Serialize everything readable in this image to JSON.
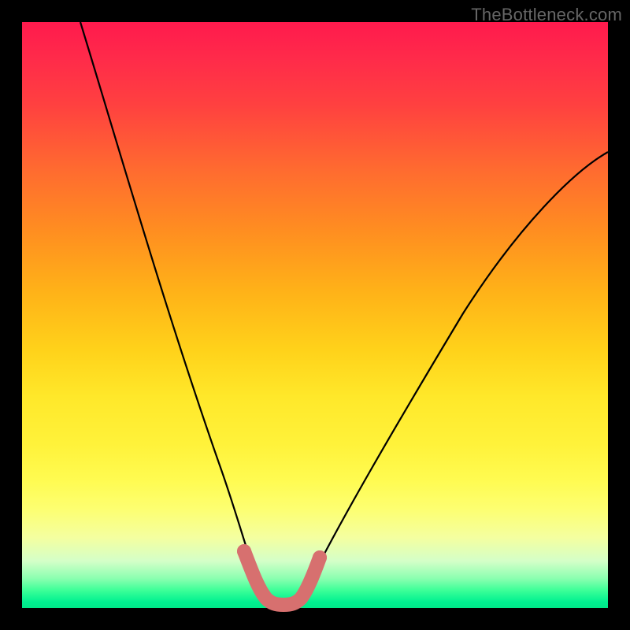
{
  "watermark": "TheBottleneck.com",
  "chart_data": {
    "type": "line",
    "title": "",
    "xlabel": "",
    "ylabel": "",
    "xlim": [
      0,
      100
    ],
    "ylim": [
      0,
      100
    ],
    "grid": false,
    "legend": false,
    "background": "rainbow-vertical",
    "series": [
      {
        "name": "bottleneck-curve",
        "color": "#000000",
        "x": [
          10,
          12,
          14,
          16,
          18,
          20,
          22,
          24,
          26,
          28,
          30,
          32,
          34,
          36,
          38,
          39,
          40,
          41,
          42,
          43,
          45,
          47,
          49,
          52,
          56,
          60,
          65,
          70,
          76,
          82,
          88,
          94,
          100
        ],
        "values": [
          100,
          92,
          84,
          77,
          70,
          63,
          57,
          51,
          45,
          39,
          33,
          27,
          22,
          16,
          10,
          6,
          3,
          1,
          1,
          1,
          3,
          6,
          10,
          15,
          21,
          28,
          35,
          42,
          50,
          57,
          64,
          70,
          76
        ]
      },
      {
        "name": "valley-highlight",
        "color": "#d7706f",
        "thickness": "thick",
        "x": [
          37.5,
          38.5,
          39.5,
          40.5,
          41.5,
          42.5,
          43.5,
          45.0,
          46.5,
          48.0
        ],
        "values": [
          9.0,
          5.5,
          3.0,
          1.5,
          1.0,
          1.0,
          1.5,
          3.0,
          5.0,
          8.5
        ]
      }
    ]
  }
}
